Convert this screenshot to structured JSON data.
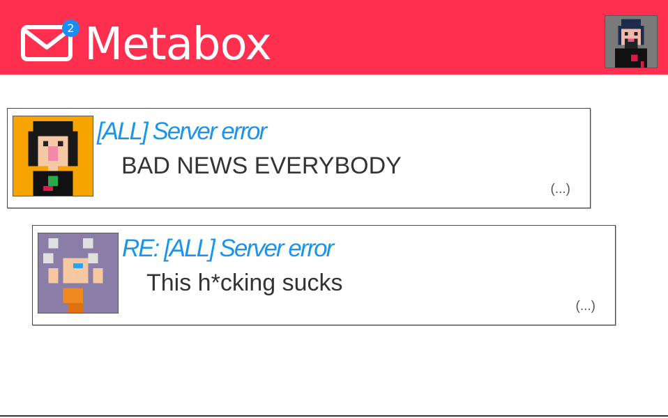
{
  "header": {
    "app_title": "Metabox",
    "unread_count": "2",
    "icons": {
      "mail": "mail-envelope-icon",
      "user": "user-avatar"
    },
    "colors": {
      "header_bg": "#fe2f4f",
      "badge_bg": "#1a8ef0",
      "subject": "#1a94ee"
    }
  },
  "messages": [
    {
      "subject": "[ALL] Server error",
      "preview": "BAD NEWS EVERYBODY",
      "more": "(...)"
    },
    {
      "subject": "RE: [ALL] Server error",
      "preview": "This h*cking sucks",
      "more": "(...)"
    }
  ]
}
